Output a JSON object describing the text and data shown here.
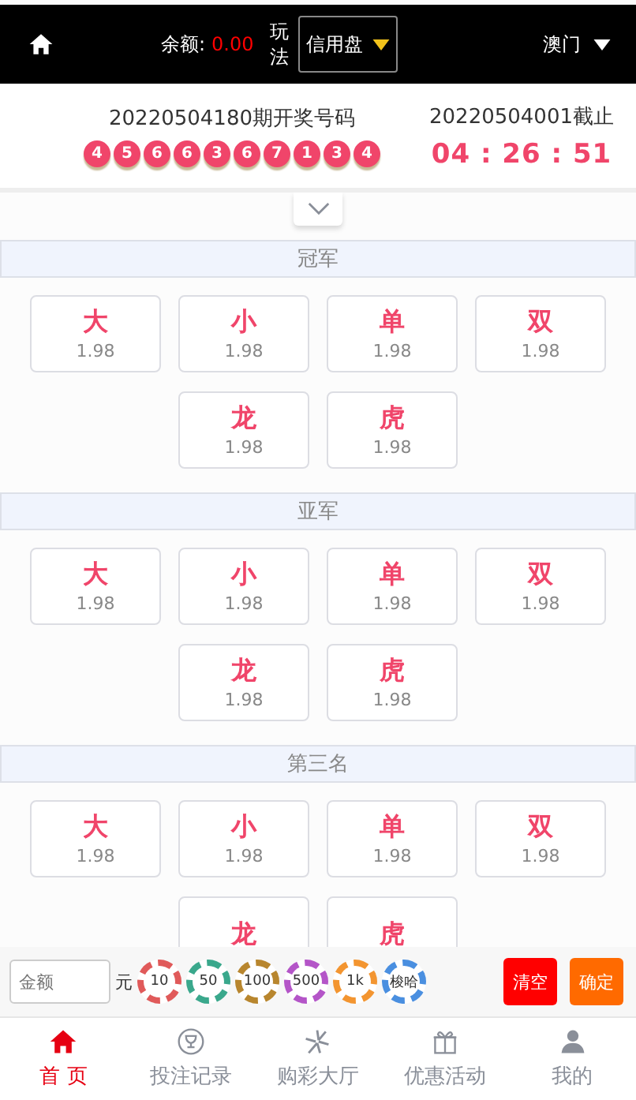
{
  "header": {
    "balance_label": "余额:",
    "balance": "0.00",
    "play_label": "玩法",
    "play_mode": "信用盘",
    "region": "澳门"
  },
  "draw": {
    "title": "20220504180期开奖号码",
    "numbers": [
      "4",
      "5",
      "6",
      "6",
      "3",
      "6",
      "7",
      "1",
      "3",
      "4"
    ],
    "next_title": "20220504001截止",
    "countdown": "04 : 26 : 51"
  },
  "sections": [
    {
      "title": "冠军",
      "options": [
        {
          "label": "大",
          "odds": "1.98"
        },
        {
          "label": "小",
          "odds": "1.98"
        },
        {
          "label": "单",
          "odds": "1.98"
        },
        {
          "label": "双",
          "odds": "1.98"
        },
        {
          "label": "龙",
          "odds": "1.98"
        },
        {
          "label": "虎",
          "odds": "1.98"
        }
      ]
    },
    {
      "title": "亚军",
      "options": [
        {
          "label": "大",
          "odds": "1.98"
        },
        {
          "label": "小",
          "odds": "1.98"
        },
        {
          "label": "单",
          "odds": "1.98"
        },
        {
          "label": "双",
          "odds": "1.98"
        },
        {
          "label": "龙",
          "odds": "1.98"
        },
        {
          "label": "虎",
          "odds": "1.98"
        }
      ]
    },
    {
      "title": "第三名",
      "options": [
        {
          "label": "大",
          "odds": "1.98"
        },
        {
          "label": "小",
          "odds": "1.98"
        },
        {
          "label": "单",
          "odds": "1.98"
        },
        {
          "label": "双",
          "odds": "1.98"
        },
        {
          "label": "龙"
        },
        {
          "label": "虎"
        }
      ]
    }
  ],
  "bet_bar": {
    "amount_placeholder": "金额",
    "unit": "元",
    "chips": [
      {
        "label": "10",
        "color": "#e05a5a"
      },
      {
        "label": "50",
        "color": "#3aa88c"
      },
      {
        "label": "100",
        "color": "#b8862e"
      },
      {
        "label": "500",
        "color": "#b455c8"
      },
      {
        "label": "1k",
        "color": "#f39530"
      },
      {
        "label": "梭哈",
        "color": "#4a8fe0"
      }
    ],
    "clear": "清空",
    "confirm": "确定"
  },
  "tabs": [
    {
      "label": "首 页",
      "kind": "home",
      "selected": true
    },
    {
      "label": "投注记录",
      "kind": "trophy",
      "selected": false
    },
    {
      "label": "购彩大厅",
      "kind": "star",
      "selected": false
    },
    {
      "label": "优惠活动",
      "kind": "gift",
      "selected": false
    },
    {
      "label": "我的",
      "kind": "user",
      "selected": false
    }
  ]
}
